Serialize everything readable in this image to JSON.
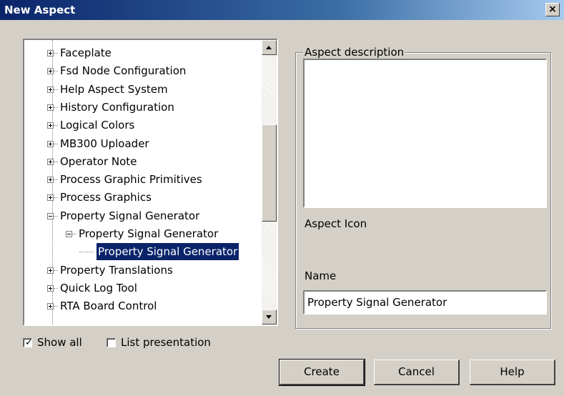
{
  "window": {
    "title": "New Aspect",
    "close_glyph": "×"
  },
  "tree": {
    "items": [
      {
        "label": "Faceplate",
        "level": 0,
        "state": "collapsed"
      },
      {
        "label": "Fsd Node Configuration",
        "level": 0,
        "state": "collapsed"
      },
      {
        "label": "Help Aspect System",
        "level": 0,
        "state": "collapsed"
      },
      {
        "label": "History Configuration",
        "level": 0,
        "state": "collapsed"
      },
      {
        "label": "Logical Colors",
        "level": 0,
        "state": "collapsed"
      },
      {
        "label": "MB300 Uploader",
        "level": 0,
        "state": "collapsed"
      },
      {
        "label": "Operator Note",
        "level": 0,
        "state": "collapsed"
      },
      {
        "label": "Process Graphic Primitives",
        "level": 0,
        "state": "collapsed"
      },
      {
        "label": "Process Graphics",
        "level": 0,
        "state": "collapsed"
      },
      {
        "label": "Property Signal Generator",
        "level": 0,
        "state": "expanded"
      },
      {
        "label": "Property Signal Generator",
        "level": 1,
        "state": "expanded"
      },
      {
        "label": "Property Signal Generator",
        "level": 2,
        "state": "leaf",
        "selected": true
      },
      {
        "label": "Property Translations",
        "level": 0,
        "state": "collapsed"
      },
      {
        "label": "Quick Log Tool",
        "level": 0,
        "state": "collapsed"
      },
      {
        "label": "RTA Board Control",
        "level": 0,
        "state": "collapsed"
      }
    ]
  },
  "details": {
    "description_label": "Aspect description",
    "description_value": "",
    "icon_label": "Aspect Icon",
    "name_label": "Name",
    "name_value": "Property Signal Generator"
  },
  "options": {
    "show_all_label": "Show all",
    "show_all_checked": true,
    "list_presentation_label": "List presentation",
    "list_presentation_checked": false,
    "check_glyph": "✓"
  },
  "buttons": {
    "create": "Create",
    "cancel": "Cancel",
    "help": "Help"
  }
}
